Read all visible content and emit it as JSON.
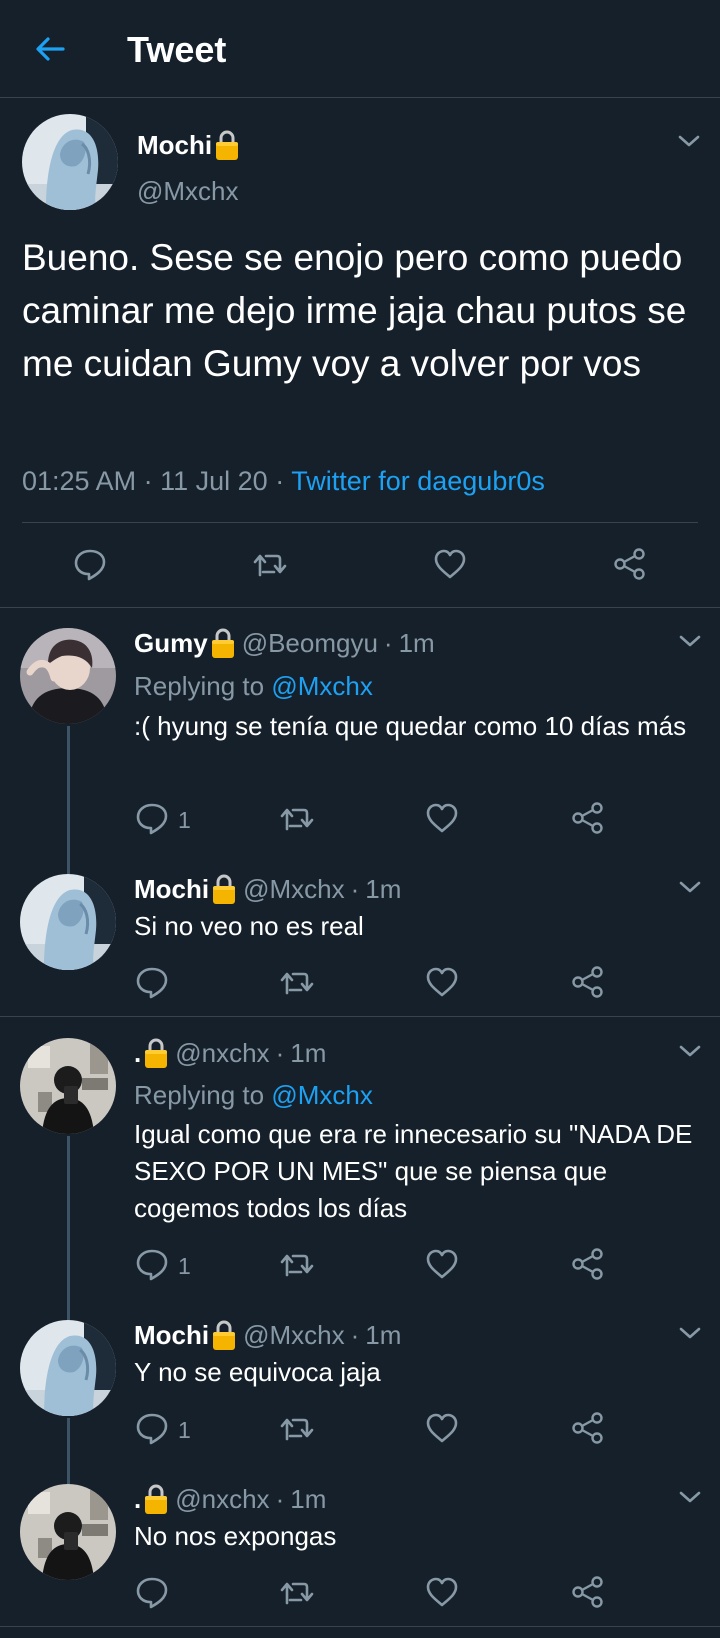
{
  "header": {
    "title": "Tweet"
  },
  "main_tweet": {
    "name": "Mochi",
    "handle": "@Mxchx",
    "text": "Bueno. Sese se enojo pero como puedo caminar me dejo irme jaja chau putos se me cuidan Gumy voy a volver por vos",
    "time": "01:25 AM",
    "date": "11 Jul 20",
    "separator": "·",
    "client": "Twitter for daegubr0s"
  },
  "replies": [
    {
      "name": "Gumy",
      "handle": "@Beomgyu",
      "time": "1m",
      "replying_prefix": "Replying to",
      "replying_to": "@Mxchx",
      "text": ":( hyung se tenía que quedar como 10 días más",
      "reply_count": "1"
    },
    {
      "name": "Mochi",
      "handle": "@Mxchx",
      "time": "1m",
      "text": "Si no veo no es real",
      "reply_count": ""
    },
    {
      "name": ".",
      "handle": "@nxchx",
      "time": "1m",
      "replying_prefix": "Replying to",
      "replying_to": "@Mxchx",
      "text": "Igual como que era re innecesario su \"NADA DE SEXO POR UN MES\" que se piensa que cogemos todos los días",
      "reply_count": "1"
    },
    {
      "name": "Mochi",
      "handle": "@Mxchx",
      "time": "1m",
      "text": "Y no se equivoca jaja",
      "reply_count": "1"
    },
    {
      "name": ".",
      "handle": "@nxchx",
      "time": "1m",
      "text": "No nos expongas",
      "reply_count": ""
    }
  ],
  "icons": {
    "back": "arrow-left-icon",
    "chevron": "chevron-down-icon",
    "lock": "lock-icon",
    "reply": "reply-icon",
    "retweet": "retweet-icon",
    "like": "heart-icon",
    "share": "share-icon"
  },
  "colors": {
    "background": "#15202b",
    "text": "#ffffff",
    "secondary": "#8899a6",
    "accent": "#1da1f2",
    "divider": "#38444d",
    "lock_body": "#f5b400"
  }
}
